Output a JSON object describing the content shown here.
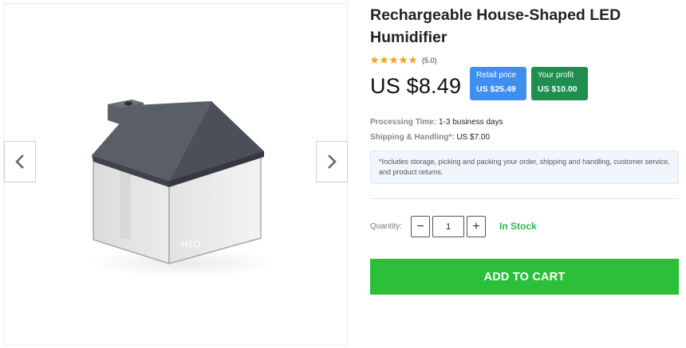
{
  "product": {
    "title": "Rechargeable House-Shaped LED Humidifier",
    "rating": 5,
    "rating_text": "(5.0)",
    "price": "US $8.49",
    "image_icon": "house-humidifier-image",
    "image_logo": "H2O"
  },
  "retail": {
    "label": "Retail price",
    "value": "US $25.49"
  },
  "profit": {
    "label": "Your profit",
    "value": "US $10.00"
  },
  "processing": {
    "label": "Processing Time:",
    "value": "1-3 business days"
  },
  "shipping": {
    "label": "Shipping & Handling*:",
    "value": "US $7.00"
  },
  "note": "*Includes storage, picking and packing your order, shipping and handling, customer service, and product returns.",
  "quantity": {
    "label": "Quantity:",
    "value": "1",
    "minus": "−",
    "plus": "+"
  },
  "stock": "In Stock",
  "cart_button": "ADD TO CART",
  "colors": {
    "accent_green": "#2bbf3a",
    "stock_green": "#2db84c",
    "retail_blue": "#3f8ff0",
    "profit_green": "#1e8f4e",
    "star": "#f5a623"
  },
  "icons": {
    "prev": "chevron-left-icon",
    "next": "chevron-right-icon",
    "star": "star-icon"
  }
}
